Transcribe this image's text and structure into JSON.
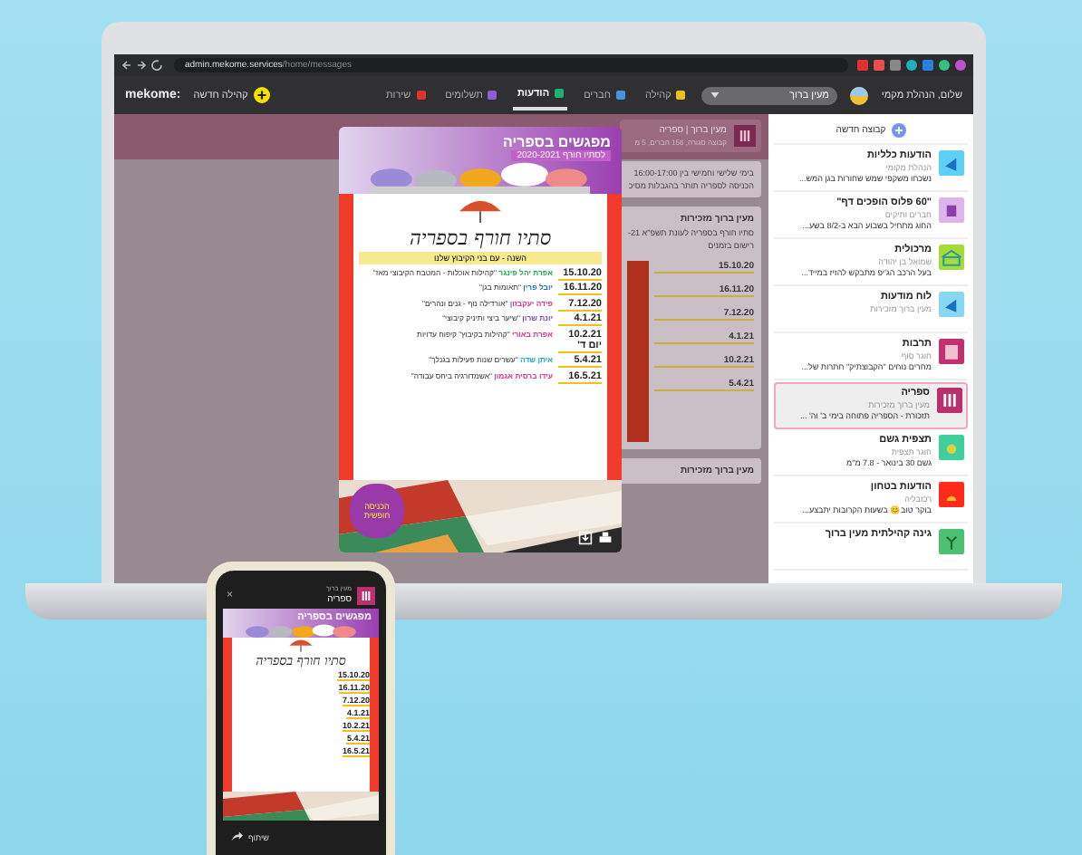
{
  "browser": {
    "host": "admin.mekome.services",
    "path": "/home/messages"
  },
  "appbar": {
    "logo": "mekome:",
    "new_community": "קהילה חדשה",
    "greeting": "שלום, הנהלת מקמי",
    "search": {
      "value": "מעין ברוך"
    },
    "nav": [
      {
        "label": "קהילה",
        "kind": "community",
        "selected": false
      },
      {
        "label": "חברים",
        "kind": "members",
        "selected": false
      },
      {
        "label": "הודעות",
        "kind": "messages",
        "selected": true
      },
      {
        "label": "תשלומים",
        "kind": "payments",
        "selected": false
      },
      {
        "label": "שירות",
        "kind": "service",
        "selected": false
      }
    ]
  },
  "sidebar": {
    "new_group": "קבוצה חדשה",
    "groups": [
      {
        "title": "הודעות כלליות",
        "subtitle": "הנהלת מקומי",
        "preview": "נשכחו משקפי שמש שחורות בגן המש...",
        "color": "#5fd0f5",
        "kind": "megaphone",
        "selected": false
      },
      {
        "title": "\"60 פלוס הופכים דף\"",
        "subtitle": "חברים ותיקים",
        "preview": "החוג מתחיל בשבוע הבא ב-8/2 בשע...",
        "color": "#dcb6ea",
        "kind": "plus",
        "selected": false
      },
      {
        "title": "מרכולית",
        "subtitle": "שמואל בן יהודה",
        "preview": "בעל הרכב הג'יפ מתבקש להזיז במייד...",
        "color": "#a6dc3a",
        "kind": "shop",
        "selected": false
      },
      {
        "title": "לוח מודעות",
        "subtitle": "מעין ברוך מזכירות",
        "color": "#86d8f2",
        "kind": "megaphone",
        "selected": false
      },
      {
        "title": "תרבות",
        "subtitle": "חוגר סוף",
        "preview": "מחרים נוחים \"הקבוצתיק\" חתרות של...",
        "color": "#c4306f",
        "kind": "stage",
        "selected": false
      },
      {
        "title": "ספריה",
        "subtitle": "מעין ברוך מזכירות",
        "preview": "תזכורת - הספריה פתוחה בימי ב' וה' ...",
        "color": "#b8306c",
        "kind": "books",
        "selected": true
      },
      {
        "title": "תצפית גשם",
        "subtitle": "חוגר תצפית",
        "preview": "גשם 30 בינואר - 7.8 מ\"מ",
        "color": "#3fcf9c",
        "kind": "drop",
        "selected": false
      },
      {
        "title": "הודעות בטחון",
        "subtitle": "רכזבליה",
        "preview": "בוקר טוב😊 בשעות הקרובות יתבצע...",
        "color": "#ff2a1a",
        "kind": "siren",
        "selected": false
      },
      {
        "title": "גינה קהילתית מעין ברוך",
        "color": "#4cc070",
        "kind": "plant",
        "selected": false
      }
    ]
  },
  "group_header": {
    "title": "מעין ברוך | ספריה",
    "subtitle": "קבוצה סגורה, 156 חברים, 5 מ"
  },
  "posts": [
    {
      "kind": "note",
      "lines": [
        "בימי שלישי וחמישי בין 16:00-17:00",
        "הכניסה לספריה תותר בהגבלות מסיכ"
      ]
    },
    {
      "kind": "poster",
      "author": "מעין ברוך מזכירות",
      "lines": [
        "סתיו חורף בספריה לעונת תשפ\"א 21-",
        "רישום בזמנים"
      ],
      "dates": [
        "15.10.20",
        "16.11.20",
        "7.12.20",
        "4.1.21",
        "10.2.21",
        "5.4.21"
      ]
    },
    {
      "kind": "title",
      "author": "מעין ברוך מזכירות"
    }
  ],
  "poster": {
    "heading": "מפגשים בספריה",
    "season": "לסתיו חורף 2020-2021",
    "title": "סתיו חורף בספריה",
    "tagline": "השנה - עם בני הקיבוץ שלנו",
    "badge": "הכניסה חופשית",
    "events": [
      {
        "date": "15.10.20",
        "name": "אפרת יהל פינגר",
        "topic": "\"קהילות אוכלות - המטבח הקיבוצי מאז\"",
        "color": "#1aa653"
      },
      {
        "date": "16.11.20",
        "name": "יובל פרין",
        "topic": "\"תאומות בגן\"",
        "color": "#1f6fd0"
      },
      {
        "date": "7.12.20",
        "name": "פידה יעקבזון",
        "topic": "\"אורדילה נוף - גנים ונהרים\"",
        "color": "#e0308a"
      },
      {
        "date": "4.1.21",
        "name": "יונת שרון",
        "topic": "\"שיער ביצי ותיניק קיבוצי\"",
        "color": "#8a3fc0"
      },
      {
        "date": "10.2.21",
        "day": "יום ד'",
        "name": "אפרת באורי",
        "topic": "\"קהילות בקיבוץ\" קיפוח עדויות",
        "color": "#e0308a"
      },
      {
        "date": "5.4.21",
        "name": "איתן שדה",
        "topic": "\"עשרים שנות פעילות בגנלך\"",
        "color": "#18a8c8"
      },
      {
        "date": "16.5.21",
        "name": "עידו ברסית אגמון",
        "topic": "\"אשמדורגיה ביחס עבודה\"",
        "color": "#e0308a"
      }
    ]
  },
  "phone": {
    "group": "מעין ברוך",
    "title": "ספריה",
    "close": "×",
    "share": "שיתוף",
    "poster": {
      "heading": "מפגשים בספריה",
      "title": "סתיו חורף בספריה",
      "dates": [
        "15.10.20",
        "16.11.20",
        "7.12.20",
        "4.1.21",
        "10.2.21",
        "5.4.21",
        "16.5.21"
      ]
    }
  }
}
